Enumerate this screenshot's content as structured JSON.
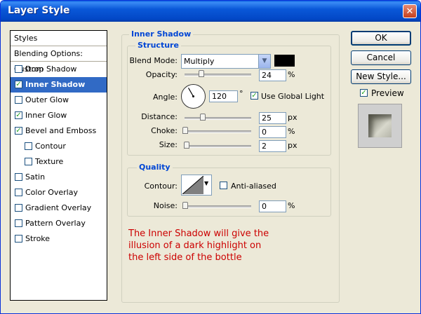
{
  "window": {
    "title": "Layer Style"
  },
  "styles_panel": {
    "header": "Styles",
    "blending": "Blending Options: Custom",
    "items": [
      {
        "label": "Drop Shadow",
        "checked": false,
        "selected": false,
        "indent": false
      },
      {
        "label": "Inner Shadow",
        "checked": true,
        "selected": true,
        "indent": false
      },
      {
        "label": "Outer Glow",
        "checked": false,
        "selected": false,
        "indent": false
      },
      {
        "label": "Inner Glow",
        "checked": true,
        "selected": false,
        "indent": false
      },
      {
        "label": "Bevel and Emboss",
        "checked": true,
        "selected": false,
        "indent": false
      },
      {
        "label": "Contour",
        "checked": false,
        "selected": false,
        "indent": true
      },
      {
        "label": "Texture",
        "checked": false,
        "selected": false,
        "indent": true
      },
      {
        "label": "Satin",
        "checked": false,
        "selected": false,
        "indent": false
      },
      {
        "label": "Color Overlay",
        "checked": false,
        "selected": false,
        "indent": false
      },
      {
        "label": "Gradient Overlay",
        "checked": false,
        "selected": false,
        "indent": false
      },
      {
        "label": "Pattern Overlay",
        "checked": false,
        "selected": false,
        "indent": false
      },
      {
        "label": "Stroke",
        "checked": false,
        "selected": false,
        "indent": false
      }
    ]
  },
  "inner_shadow": {
    "title": "Inner Shadow",
    "structure": {
      "title": "Structure",
      "blend_mode_label": "Blend Mode:",
      "blend_mode": "Multiply",
      "shadow_color": "#000000",
      "opacity_label": "Opacity:",
      "opacity": "24",
      "opacity_unit": "%",
      "angle_label": "Angle:",
      "angle": "120",
      "angle_unit": "°",
      "global_light_label": "Use Global Light",
      "global_light": true,
      "distance_label": "Distance:",
      "distance": "25",
      "distance_unit": "px",
      "choke_label": "Choke:",
      "choke": "0",
      "choke_unit": "%",
      "size_label": "Size:",
      "size": "2",
      "size_unit": "px"
    },
    "quality": {
      "title": "Quality",
      "contour_label": "Contour:",
      "anti_aliased_label": "Anti-aliased",
      "anti_aliased": false,
      "noise_label": "Noise:",
      "noise": "0",
      "noise_unit": "%"
    }
  },
  "note_lines": [
    "The Inner Shadow will give the",
    "illusion of a dark highlight on",
    "the left side of the bottle"
  ],
  "buttons": {
    "ok": "OK",
    "cancel": "Cancel",
    "new_style": "New Style...",
    "preview_label": "Preview",
    "preview": true
  },
  "colors": {
    "accent": "#316ac5",
    "group_title": "#0046d5",
    "note": "#cc0000"
  }
}
